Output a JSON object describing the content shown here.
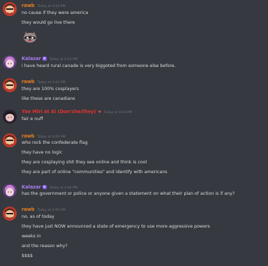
{
  "colors": {
    "background": "#36393f",
    "rawb": "#e67e22",
    "kalazar": "#a87cf5",
    "third_user": "#e0342f",
    "message_text": "#dcddde",
    "timestamp": "#72767d"
  },
  "messages": [
    {
      "user": "rawb",
      "time": "Today at 4:03 PM",
      "avatar": "rawb-avatar",
      "lines": [
        "no cause if they were america",
        "they would go live there"
      ],
      "has_emoji": true
    },
    {
      "user": "Kalazar",
      "time": "Today at 4:03 PM",
      "avatar": "kalazar-avatar",
      "lines": [
        "i have heard rural canade is very biggoted from someone else before."
      ]
    },
    {
      "user": "rawb",
      "time": "Today at 4:03 PM",
      "avatar": "rawb-avatar",
      "lines": [
        "they are 100% cosplayers",
        "like these are canadians"
      ]
    },
    {
      "user": "Yae Miri at Ai (Don'she/they)",
      "time": "Today at 4:03 PM",
      "avatar": "red-avatar",
      "lines": [
        "fair e nuff"
      ]
    },
    {
      "user": "rawb",
      "time": "Today at 4:03 PM",
      "avatar": "rawb-avatar",
      "lines": [
        "who rock the confederate flag",
        "they have no logic",
        "they are cosplaying shit they see online and think is cool",
        "they are part of online \"communities\" and identify with americans"
      ]
    },
    {
      "user": "Kalazar",
      "time": "Today at 4:04 PM",
      "avatar": "kalazar-avatar",
      "lines": [
        "has the government or police or anyone given a statement on what their plan of action is if any?"
      ]
    },
    {
      "user": "rawb",
      "time": "Today at 4:05 PM",
      "avatar": "rawb-avatar",
      "lines": [
        "no. as of today",
        "they have just NOW announced a state of emergency to use more aggressive powers",
        "weeks in",
        "and the reason why?",
        "$$$$"
      ]
    }
  ]
}
